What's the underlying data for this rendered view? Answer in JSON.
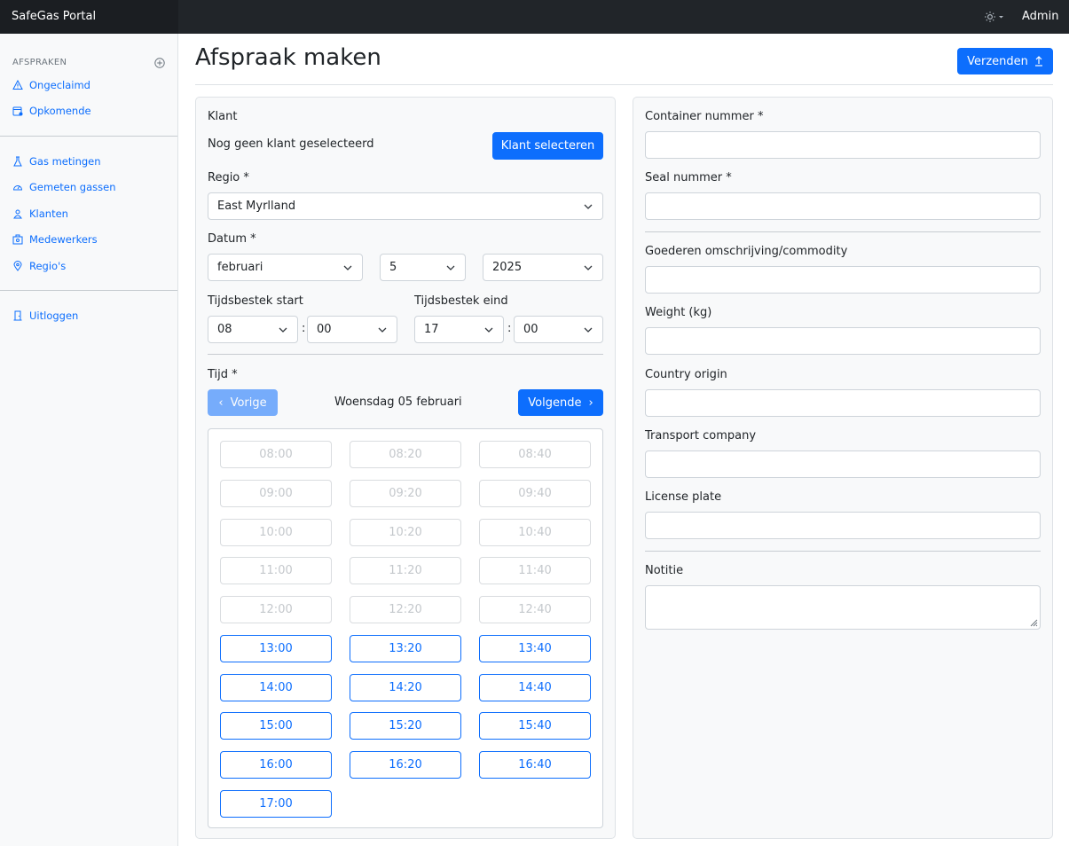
{
  "app": {
    "brand": "SafeGas Portal",
    "user": "Admin"
  },
  "sidebar": {
    "heading": "AFSPRAKEN",
    "items": [
      {
        "label": "Ongeclaimd",
        "icon": "warning-icon"
      },
      {
        "label": "Opkomende",
        "icon": "calendar-icon"
      },
      {
        "label": "Gas metingen",
        "icon": "flask-icon"
      },
      {
        "label": "Gemeten gassen",
        "icon": "speedometer-icon"
      },
      {
        "label": "Klanten",
        "icon": "person-icon"
      },
      {
        "label": "Medewerkers",
        "icon": "building-icon"
      },
      {
        "label": "Regio's",
        "icon": "location-pin-icon"
      },
      {
        "label": "Uitloggen",
        "icon": "door-icon"
      }
    ]
  },
  "page": {
    "title": "Afspraak maken",
    "submit_label": "Verzenden"
  },
  "form": {
    "klant_label": "Klant",
    "klant_empty": "Nog geen klant geselecteerd",
    "klant_button": "Klant selecteren",
    "regio_label": "Regio *",
    "regio_value": "East Myrlland",
    "datum_label": "Datum *",
    "month": "februari",
    "day": "5",
    "year": "2025",
    "start_label": "Tijdsbestek start",
    "start_hour": "08",
    "start_min": "00",
    "end_label": "Tijdsbestek eind",
    "end_hour": "17",
    "end_min": "00",
    "colon": ":",
    "tijd_label": "Tijd *",
    "prev_label": "Vorige",
    "next_label": "Volgende",
    "current_date": "Woensdag 05 februari",
    "prev_glyph": "‹",
    "next_glyph": "›"
  },
  "slots": [
    {
      "time": "08:00",
      "available": false
    },
    {
      "time": "08:20",
      "available": false
    },
    {
      "time": "08:40",
      "available": false
    },
    {
      "time": "09:00",
      "available": false
    },
    {
      "time": "09:20",
      "available": false
    },
    {
      "time": "09:40",
      "available": false
    },
    {
      "time": "10:00",
      "available": false
    },
    {
      "time": "10:20",
      "available": false
    },
    {
      "time": "10:40",
      "available": false
    },
    {
      "time": "11:00",
      "available": false
    },
    {
      "time": "11:20",
      "available": false
    },
    {
      "time": "11:40",
      "available": false
    },
    {
      "time": "12:00",
      "available": false
    },
    {
      "time": "12:20",
      "available": false
    },
    {
      "time": "12:40",
      "available": false
    },
    {
      "time": "13:00",
      "available": true
    },
    {
      "time": "13:20",
      "available": true
    },
    {
      "time": "13:40",
      "available": true
    },
    {
      "time": "14:00",
      "available": true
    },
    {
      "time": "14:20",
      "available": true
    },
    {
      "time": "14:40",
      "available": true
    },
    {
      "time": "15:00",
      "available": true
    },
    {
      "time": "15:20",
      "available": true
    },
    {
      "time": "15:40",
      "available": true
    },
    {
      "time": "16:00",
      "available": true
    },
    {
      "time": "16:20",
      "available": true
    },
    {
      "time": "16:40",
      "available": true
    },
    {
      "time": "17:00",
      "available": true
    }
  ],
  "details": {
    "container_label": "Container nummer *",
    "seal_label": "Seal nummer *",
    "goods_label": "Goederen omschrijving/commodity",
    "weight_label": "Weight (kg)",
    "country_label": "Country origin",
    "transport_label": "Transport company",
    "plate_label": "License plate",
    "note_label": "Notitie"
  },
  "colors": {
    "primary": "#0d6efd",
    "topbar": "#212529",
    "sidebar": "#f8f9fa"
  }
}
